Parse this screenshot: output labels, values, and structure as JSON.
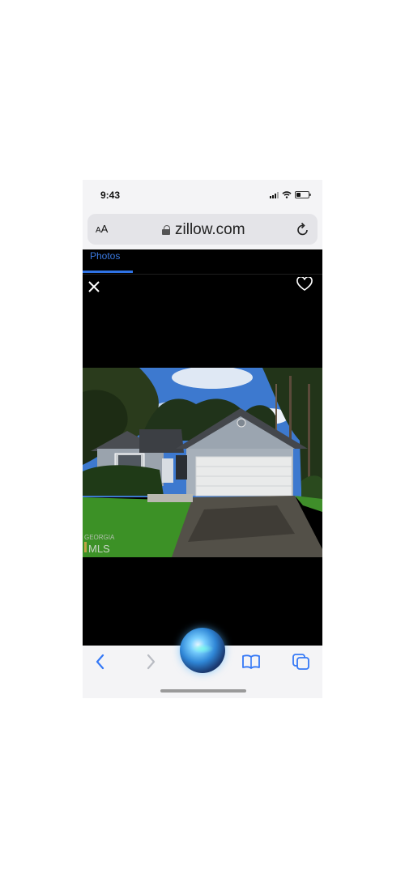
{
  "status_bar": {
    "time": "9:43"
  },
  "browser": {
    "aa_label_small": "A",
    "aa_label": "A",
    "url": "zillow.com"
  },
  "listing": {
    "tab_label": "Photos",
    "photo_watermark_top": "GEORGIA",
    "photo_watermark_bottom": "MLS"
  },
  "icons": {
    "signal": "cellular-signal-icon",
    "wifi": "wifi-icon",
    "battery": "battery-icon",
    "lock": "lock-icon",
    "reload": "reload-icon",
    "close": "close-icon",
    "favorite": "heart-icon",
    "back": "chevron-left-icon",
    "forward": "chevron-right-icon",
    "bookmarks": "book-icon",
    "tabs": "tabs-icon",
    "siri": "siri-orb-icon"
  },
  "colors": {
    "accent": "#2f73e6",
    "toolbar_bg": "#f4f4f6",
    "url_pill": "#e4e4e8",
    "viewer_bg": "#000000"
  }
}
